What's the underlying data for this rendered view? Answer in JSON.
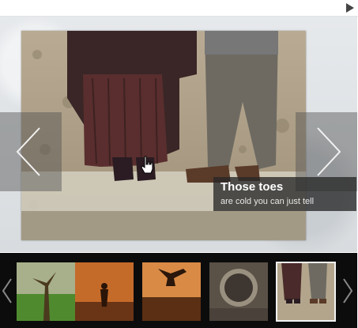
{
  "slideshow": {
    "caption": {
      "title": "Those toes",
      "subtitle": "are cold you can just tell"
    },
    "thumbnails": [
      {
        "name": "tree-on-grass"
      },
      {
        "name": "orange-sky-figure"
      },
      {
        "name": "jumping-figure-sunset"
      },
      {
        "name": "pipe-view"
      },
      {
        "name": "feet-on-beach",
        "selected": true
      }
    ]
  },
  "icons": {
    "play": "play-icon",
    "prev": "chevron-left-icon",
    "next": "chevron-right-icon"
  }
}
